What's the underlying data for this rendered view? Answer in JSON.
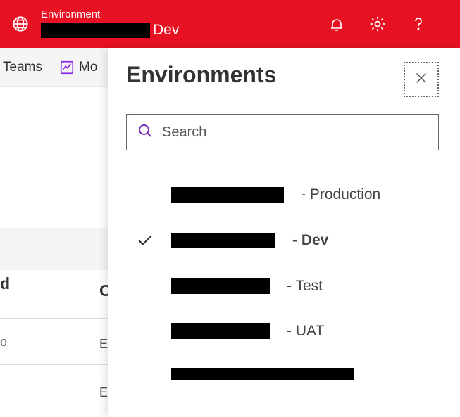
{
  "header": {
    "env_label": "Environment",
    "env_value_suffix": "Dev"
  },
  "subnav": {
    "teams": "Teams",
    "more": "Mo"
  },
  "peek": {
    "col1": "d",
    "col2": "C",
    "row1": "o",
    "row2a": "E",
    "row2b": "E"
  },
  "panel": {
    "title": "Environments",
    "search_placeholder": "Search",
    "items": [
      {
        "suffix": "- Production",
        "selected": false,
        "redact_w": 160
      },
      {
        "suffix": "- Dev",
        "selected": true,
        "redact_w": 148
      },
      {
        "suffix": "- Test",
        "selected": false,
        "redact_w": 140
      },
      {
        "suffix": "- UAT",
        "selected": false,
        "redact_w": 140
      }
    ]
  }
}
